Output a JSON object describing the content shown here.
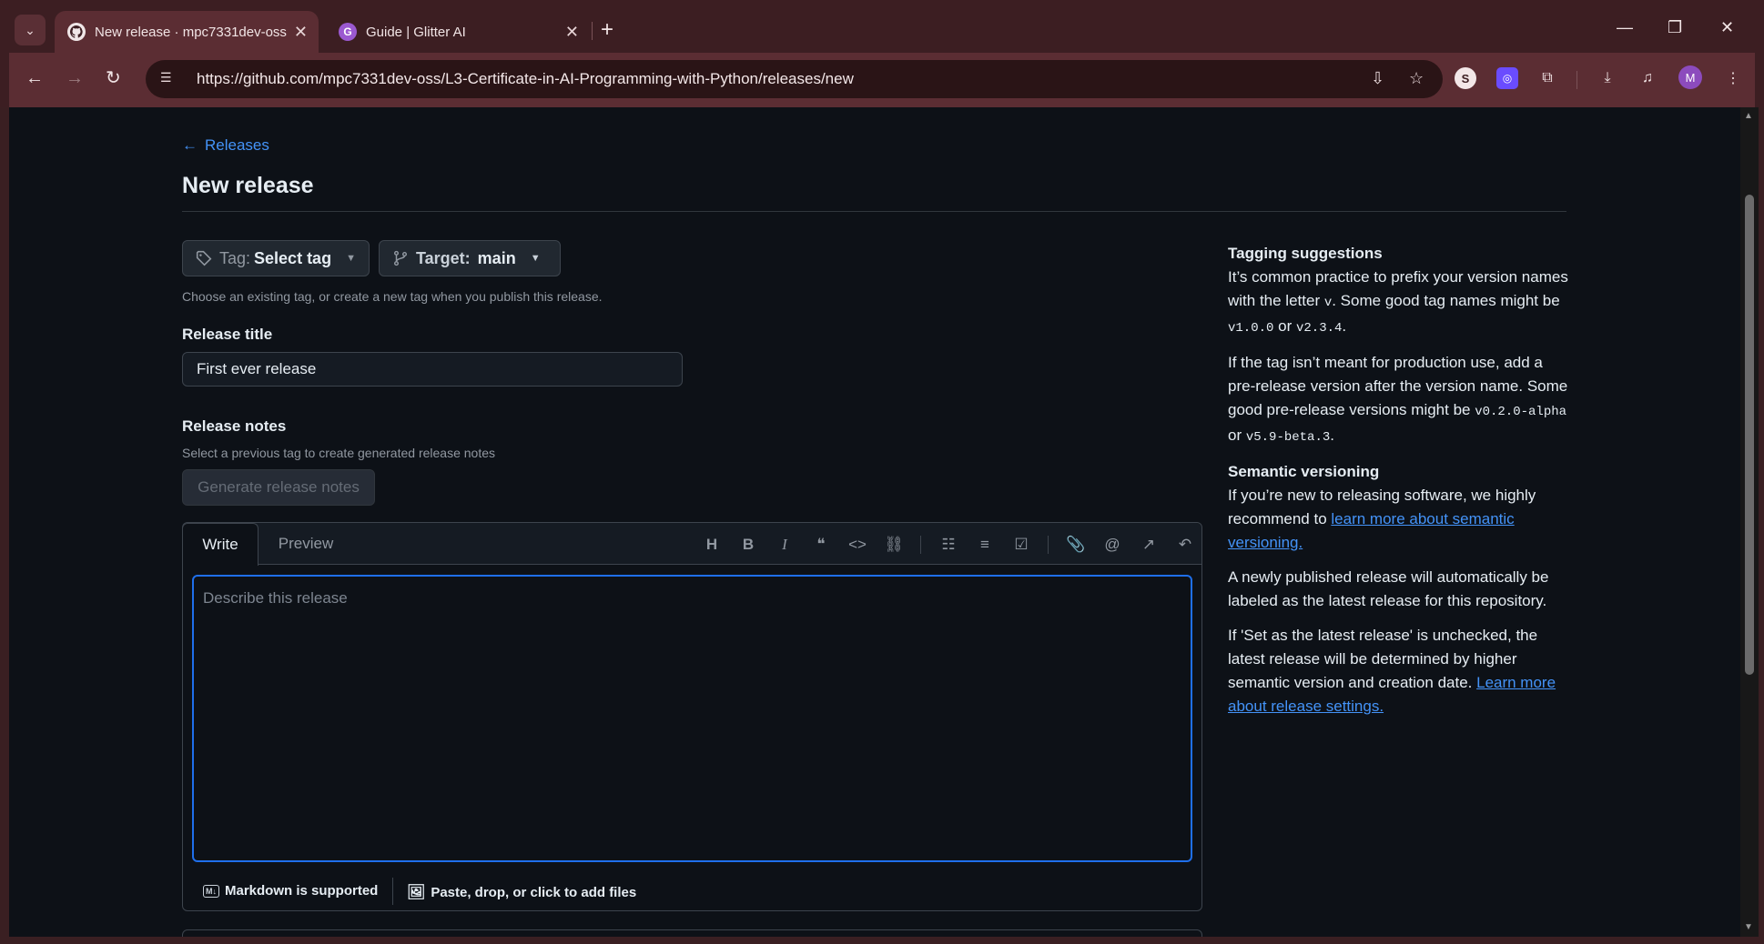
{
  "browser": {
    "tabs": [
      {
        "title": "New release · mpc7331dev-oss/",
        "icon": "github-icon"
      },
      {
        "title": "Guide | Glitter AI",
        "icon": "glitter-icon"
      }
    ],
    "url": "https://github.com/mpc7331dev-oss/L3-Certificate-in-AI-Programming-with-Python/releases/new",
    "profile_initial": "M"
  },
  "page": {
    "back_link": "Releases",
    "title": "New release",
    "tag_button": {
      "prefix": "Tag:",
      "value": "Select tag"
    },
    "target_button": {
      "prefix": "Target:",
      "value": "main"
    },
    "tag_hint": "Choose an existing tag, or create a new tag when you publish this release.",
    "release_title_label": "Release title",
    "release_title_value": "First ever release",
    "release_notes_label": "Release notes",
    "release_notes_hint": "Select a previous tag to create generated release notes",
    "generate_button": "Generate release notes",
    "editor": {
      "tab_write": "Write",
      "tab_preview": "Preview",
      "placeholder": "Describe this release",
      "markdown_note": "Markdown is supported",
      "attach_note": "Paste, drop, or click to add files",
      "toolbar": [
        "heading-icon",
        "bold-icon",
        "italic-icon",
        "quote-icon",
        "code-icon",
        "link-icon",
        "ordered-list-icon",
        "unordered-list-icon",
        "task-list-icon",
        "attach-icon",
        "mention-icon",
        "reference-icon",
        "undo-icon"
      ]
    }
  },
  "sidebar": {
    "tagging_heading": "Tagging suggestions",
    "tagging_p1_a": "It’s common practice to prefix your version names with the letter ",
    "tagging_p1_code1": "v",
    "tagging_p1_b": ". Some good tag names might be ",
    "tagging_p1_code2": "v1.0.0",
    "tagging_p1_c": " or ",
    "tagging_p1_code3": "v2.3.4",
    "tagging_p1_d": ".",
    "tagging_p2_a": "If the tag isn’t meant for production use, add a pre-release version after the version name. Some good pre-release versions might be ",
    "tagging_p2_code1": "v0.2.0-alpha",
    "tagging_p2_b": " or ",
    "tagging_p2_code2": "v5.9-beta.3",
    "tagging_p2_c": ".",
    "semver_heading": "Semantic versioning",
    "semver_p1_a": "If you’re new to releasing software, we highly recommend to ",
    "semver_link": "learn more about semantic versioning.",
    "semver_p2": "A newly published release will automatically be labeled as the latest release for this repository.",
    "semver_p3_a": "If 'Set as the latest release' is unchecked, the latest release will be determined by higher semantic version and creation date. ",
    "semver_p3_link": "Learn more about release settings."
  },
  "colors": {
    "accent": "#4493f8",
    "focus": "#1f6feb",
    "background": "#0d1117",
    "chrome": "#5b2d33"
  }
}
